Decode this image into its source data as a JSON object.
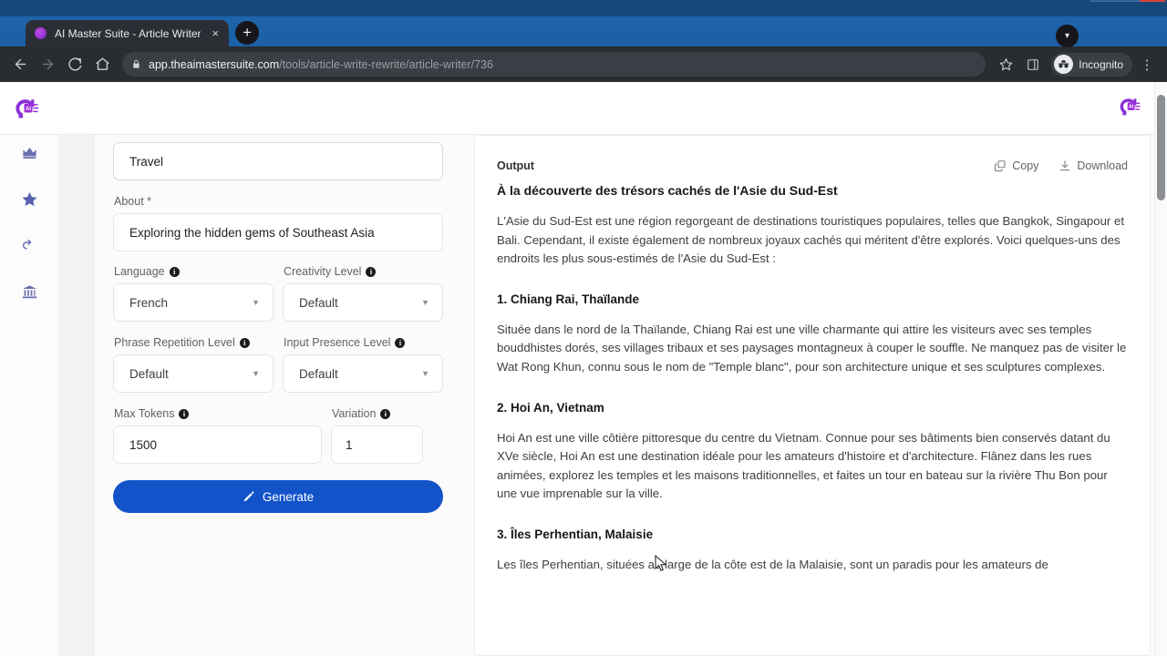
{
  "browser": {
    "tab": {
      "title": "AI Master Suite - Article Writer",
      "close_label": "×",
      "favicon": "ai-brain-favicon"
    },
    "new_tab_label": "+",
    "tabstrip_caret": "▾",
    "window_controls": {
      "minimize": "–",
      "maximize": "❐",
      "close": "✕"
    },
    "nav": {
      "back": "←",
      "forward": "→",
      "reload": "⟳",
      "home": "⌂"
    },
    "omnibox": {
      "lock_icon": "lock-icon",
      "url_domain": "app.theaimastersuite.com",
      "url_path": "/tools/article-write-rewrite/article-writer/736"
    },
    "toolbar_right": {
      "bookmark": "☆",
      "side_panel": "▣",
      "incognito_label": "Incognito",
      "menu": "⋮"
    }
  },
  "app": {
    "brand": "ai-master-suite-logo",
    "rail": [
      {
        "name": "crown-icon",
        "glyph": "♚"
      },
      {
        "name": "star-icon",
        "glyph": "★"
      },
      {
        "name": "undo-arrow-icon",
        "glyph": "↰"
      },
      {
        "name": "bank-icon",
        "glyph": "⚓"
      }
    ]
  },
  "form": {
    "topic": {
      "value": "Travel"
    },
    "about": {
      "label": "About *",
      "value": "Exploring the hidden gems of Southeast Asia"
    },
    "language": {
      "label": "Language",
      "value": "French"
    },
    "creativity": {
      "label": "Creativity Level",
      "value": "Default"
    },
    "phrase_repetition": {
      "label": "Phrase Repetition Level",
      "value": "Default"
    },
    "input_presence": {
      "label": "Input Presence Level",
      "value": "Default"
    },
    "max_tokens": {
      "label": "Max Tokens",
      "value": "1500"
    },
    "variation": {
      "label": "Variation",
      "value": "1"
    },
    "generate_button": "Generate",
    "info_glyph": "i"
  },
  "output": {
    "title": "Output",
    "copy_label": "Copy",
    "download_label": "Download",
    "article": {
      "title": "À la découverte des trésors cachés de l'Asie du Sud-Est",
      "intro": "L'Asie du Sud-Est est une région regorgeant de destinations touristiques populaires, telles que Bangkok, Singapour et Bali. Cependant, il existe également de nombreux joyaux cachés qui méritent d'être explorés. Voici quelques-uns des endroits les plus sous-estimés de l'Asie du Sud-Est :",
      "sections": [
        {
          "heading": "1. Chiang Rai, Thaïlande",
          "body": "Située dans le nord de la Thaïlande, Chiang Rai est une ville charmante qui attire les visiteurs avec ses temples bouddhistes dorés, ses villages tribaux et ses paysages montagneux à couper le souffle. Ne manquez pas de visiter le Wat Rong Khun, connu sous le nom de \"Temple blanc\", pour son architecture unique et ses sculptures complexes."
        },
        {
          "heading": "2. Hoi An, Vietnam",
          "body": "Hoi An est une ville côtière pittoresque du centre du Vietnam. Connue pour ses bâtiments bien conservés datant du XVe siècle, Hoi An est une destination idéale pour les amateurs d'histoire et d'architecture. Flânez dans les rues animées, explorez les temples et les maisons traditionnelles, et faites un tour en bateau sur la rivière Thu Bon pour une vue imprenable sur la ville."
        },
        {
          "heading": "3. Îles Perhentian, Malaisie",
          "body": "Les îles Perhentian, situées au large de la côte est de la Malaisie, sont un paradis pour les amateurs de"
        }
      ]
    }
  },
  "colors": {
    "accent_blue": "#1253ca",
    "brand_purple": "#8b2fd6",
    "chrome_blue": "#1e64ab",
    "close_red": "#cf3a31"
  }
}
